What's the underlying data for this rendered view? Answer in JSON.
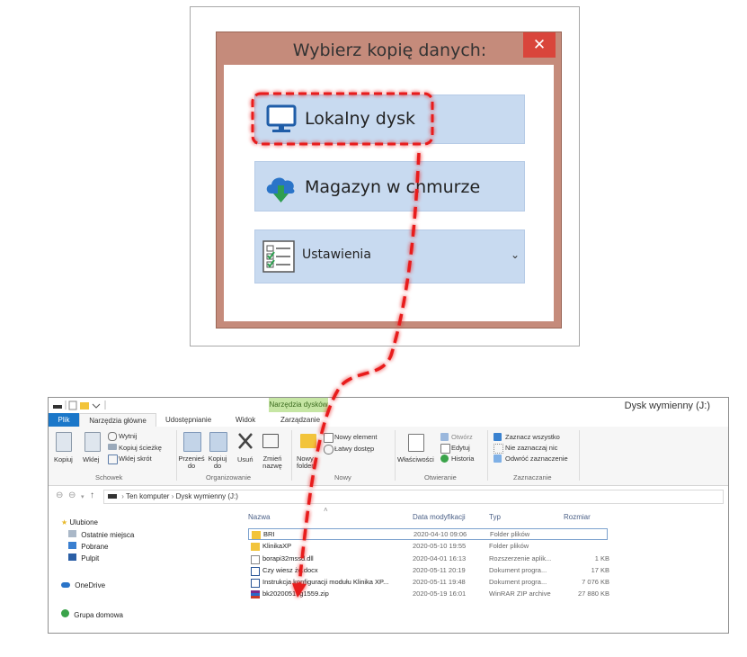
{
  "dialog": {
    "title": "Wybierz kopię danych:",
    "close_glyph": "✕",
    "options": [
      {
        "label": "Lokalny dysk",
        "icon": "monitor-icon"
      },
      {
        "label": "Magazyn w chmurze",
        "icon": "cloud-download-icon"
      },
      {
        "label": "Ustawienia",
        "icon": "checklist-icon",
        "chevron": "⌄"
      }
    ]
  },
  "explorer": {
    "window_title": "Dysk wymienny (J:)",
    "context_tab": "Narzędzia dysków",
    "tabs": [
      "Plik",
      "Narzędzia główne",
      "Udostępnianie",
      "Widok",
      "Zarządzanie"
    ],
    "ribbon": {
      "clipboard": {
        "copy": "Kopiuj",
        "paste": "Wklej",
        "cut": "Wytnij",
        "copy_path": "Kopiuj ścieżkę",
        "paste_shortcut": "Wklej skrót",
        "group": "Schowek"
      },
      "organize": {
        "move": "Przenieś do",
        "copy_to": "Kopiuj do",
        "delete": "Usuń",
        "rename": "Zmień nazwę",
        "group": "Organizowanie"
      },
      "new": {
        "new_folder": "Nowy folder",
        "new_item": "Nowy element",
        "easy_access": "Łatwy dostęp",
        "group": "Nowy"
      },
      "open": {
        "properties": "Właściwości",
        "open": "Otwórz",
        "edit": "Edytuj",
        "history": "Historia",
        "group": "Otwieranie"
      },
      "select": {
        "select_all": "Zaznacz wszystko",
        "select_none": "Nie zaznaczaj nic",
        "invert": "Odwróć zaznaczenie",
        "group": "Zaznaczanie"
      }
    },
    "address": {
      "crumbs": [
        "Ten komputer",
        "Dysk wymienny (J:)"
      ]
    },
    "nav": [
      {
        "label": "Ulubione",
        "icon": "star-icon"
      },
      {
        "label": "Ostatnie miejsca",
        "icon": "recent-icon"
      },
      {
        "label": "Pobrane",
        "icon": "downloads-icon"
      },
      {
        "label": "Pulpit",
        "icon": "desktop-icon"
      },
      {
        "label": "OneDrive",
        "icon": "onedrive-icon"
      },
      {
        "label": "Grupa domowa",
        "icon": "homegroup-icon"
      }
    ],
    "columns": [
      "Nazwa",
      "Data modyfikacji",
      "Typ",
      "Rozmiar"
    ],
    "files": [
      {
        "name": "BRI",
        "modified": "2020-04-10 09:06",
        "type": "Folder plików",
        "size": "",
        "icon": "folder-icon"
      },
      {
        "name": "KlinikaXP",
        "modified": "2020-05-10 19:55",
        "type": "Folder plików",
        "size": "",
        "icon": "folder-icon"
      },
      {
        "name": "borapi32mssd.dll",
        "modified": "2020-04-01 16:13",
        "type": "Rozszerzenie aplik...",
        "size": "1 KB",
        "icon": "dll-icon"
      },
      {
        "name": "Czy wiesz że.docx",
        "modified": "2020-05-11 20:19",
        "type": "Dokument progra...",
        "size": "17 KB",
        "icon": "word-icon"
      },
      {
        "name": "Instrukcja konfiguracji modułu Klinika XP...",
        "modified": "2020-05-11 19:48",
        "type": "Dokument progra...",
        "size": "7 076 KB",
        "icon": "word-icon"
      },
      {
        "name": "bk20200519g1559.zip",
        "modified": "2020-05-19 16:01",
        "type": "WinRAR ZIP archive",
        "size": "27 880 KB",
        "icon": "winrar-icon"
      }
    ]
  },
  "colors": {
    "accent_red": "#e81c1c",
    "option_bg": "#c8daf0",
    "dialog_frame": "#c58b7b"
  }
}
